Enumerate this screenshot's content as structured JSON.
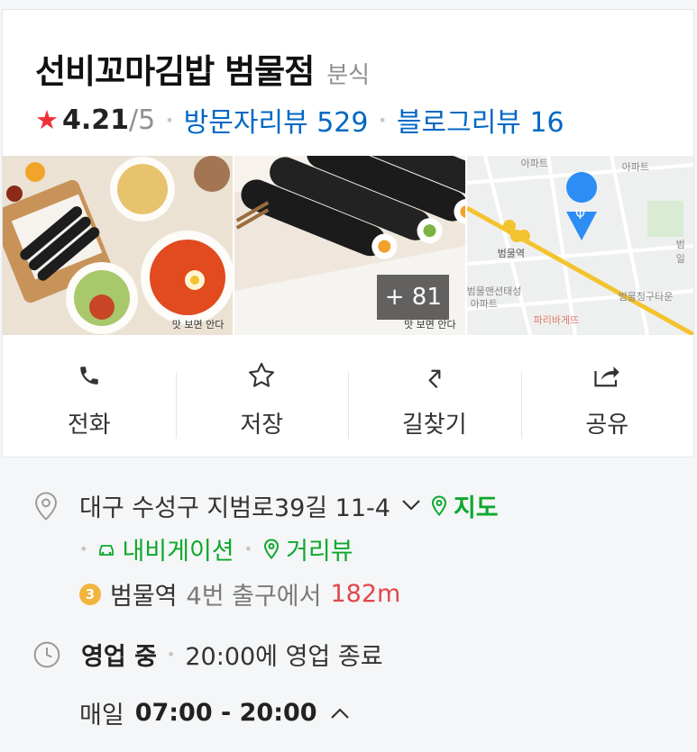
{
  "place": {
    "name": "선비꼬마김밥 범물점",
    "category": "분식",
    "rating": "4.21",
    "rating_max": "/5",
    "visitor_reviews": "방문자리뷰 529",
    "blog_reviews": "블로그리뷰 16"
  },
  "photos": {
    "watermark_1": "맛 보면 안다",
    "watermark_2": "맛 보면 안다",
    "more_count": "+ 81",
    "map_labels": [
      "아파트",
      "아파트",
      "범물역",
      "범물맨션태성",
      "아파트",
      "파리바게뜨",
      "범물청구타운",
      "범일"
    ]
  },
  "actions": [
    {
      "label": "전화",
      "icon": "phone-icon"
    },
    {
      "label": "저장",
      "icon": "star-outline-icon"
    },
    {
      "label": "길찾기",
      "icon": "directions-icon"
    },
    {
      "label": "공유",
      "icon": "share-icon"
    }
  ],
  "info": {
    "address": "대구 수성구 지범로39길 11-4",
    "map_link": "지도",
    "navigation_link": "내비게이션",
    "streetview_link": "거리뷰",
    "subway_line": "3",
    "station": "범물역",
    "exit": "4번 출구에서",
    "distance": "182m",
    "status": "영업 중",
    "close_time": "20:00에 영업 종료",
    "hours_day": "매일",
    "hours_time": "07:00 - 20:00"
  },
  "colors": {
    "accent_blue": "#0068c3",
    "accent_green": "#0ea82e",
    "star_red": "#f0303a",
    "distance_red": "#e2474a",
    "line3_orange": "#f2b43b"
  }
}
